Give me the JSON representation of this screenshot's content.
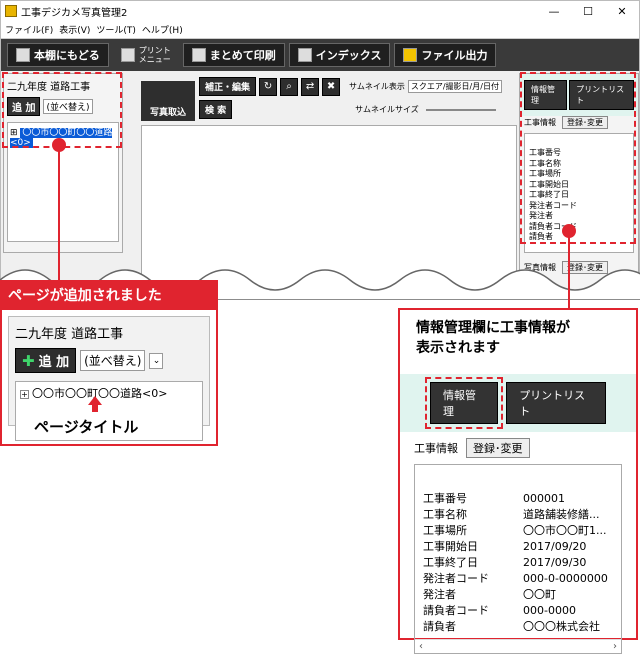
{
  "app": {
    "title": "工事デジカメ写真管理2",
    "min": "—",
    "max": "☐",
    "close": "✕"
  },
  "menu": [
    {
      "label": "ファイル(F)"
    },
    {
      "label": "表示(V)"
    },
    {
      "label": "ツール(T)"
    },
    {
      "label": "ヘルプ(H)"
    }
  ],
  "toolbar": {
    "back": "本棚にもどる",
    "print_menu": "プリント\nメニュー",
    "batch_print": "まとめて印刷",
    "index": "インデックス",
    "file_out": "ファイル出力"
  },
  "left": {
    "title": "二九年度 道路工事",
    "add": "追 加",
    "sort": "(並べ替え)",
    "tree_item": "〇〇市〇〇町〇〇道路<0>"
  },
  "center": {
    "capture": "写真取込",
    "edit": "補正・編集",
    "search": "検 索",
    "thumb_label": "サムネイル表示",
    "thumb_value": "スクエア/撮影日/月/日付",
    "thumb_size": "サムネイルサイズ"
  },
  "right": {
    "tab_info": "情報管理",
    "tab_print": "プリントリスト",
    "label": "工事情報",
    "change": "登録･変更",
    "photo_info": "写真情報"
  },
  "fields": [
    {
      "k": "工事番号",
      "v": "000001"
    },
    {
      "k": "工事名称",
      "v": "道路舗装修繕..."
    },
    {
      "k": "工事場所",
      "v": "〇〇市〇〇町1..."
    },
    {
      "k": "工事開始日",
      "v": "2017/09/20"
    },
    {
      "k": "工事終了日",
      "v": "2017/09/30"
    },
    {
      "k": "発注者コード",
      "v": "000-0-0000000"
    },
    {
      "k": "発注者",
      "v": "〇〇町"
    },
    {
      "k": "請負者コード",
      "v": "000-0000"
    },
    {
      "k": "請負者",
      "v": "〇〇〇株式会社"
    }
  ],
  "callouts": {
    "page_added": "ページが追加されました",
    "page_title": "ページタイトル",
    "info_shown": "情報管理欄に工事情報が\n表示されます"
  },
  "colors": {
    "accent": "#e0242f",
    "select": "#0a5bd7"
  }
}
